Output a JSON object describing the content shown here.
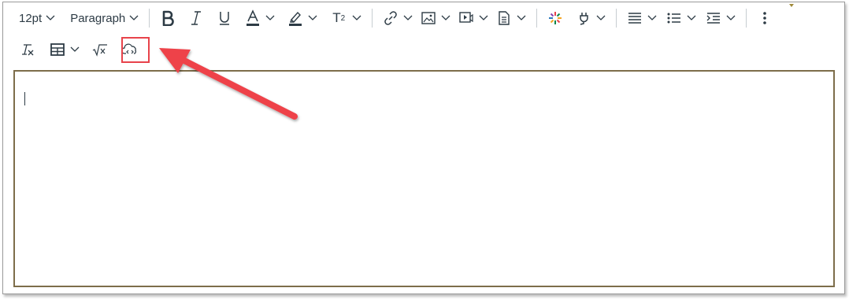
{
  "toolbar": {
    "font_size": "12pt",
    "block_format": "Paragraph",
    "superscript_label": "T",
    "superscript_exp": "2"
  },
  "editor": {
    "content": ""
  },
  "colors": {
    "highlight_box": "#e8434b",
    "arrow": "#ee4249",
    "editor_border": "#7d6d4a",
    "icon": "#2d3b45"
  },
  "icons": [
    "chevron-down-icon",
    "bold-icon",
    "italic-icon",
    "underline-icon",
    "text-color-icon",
    "highlight-color-icon",
    "superscript-icon",
    "link-icon",
    "image-icon",
    "media-icon",
    "document-icon",
    "apps-icon",
    "plug-icon",
    "align-icon",
    "list-icon",
    "indent-icon",
    "more-vertical-icon",
    "clear-format-icon",
    "table-icon",
    "equation-icon",
    "cloud-embed-icon"
  ]
}
